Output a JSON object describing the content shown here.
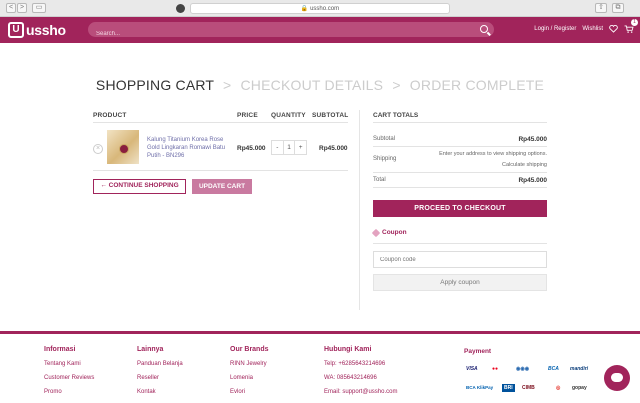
{
  "browser": {
    "url": "ussho.com",
    "nav_back": "<",
    "nav_forward": ">",
    "sidebar_toggle": "▭",
    "share": "⇧",
    "tabs": "⧉"
  },
  "header": {
    "logo_mark": "U",
    "logo_text": "ussho",
    "search_placeholder": "Search...",
    "login_register": "Login / Register",
    "wishlist": "Wishlist",
    "cart_count": "1",
    "brand_color": "#a1245b"
  },
  "steps": {
    "cart": "SHOPPING CART",
    "details": "CHECKOUT DETAILS",
    "complete": "ORDER COMPLETE",
    "separator": ">"
  },
  "cart": {
    "columns": [
      "PRODUCT",
      "PRICE",
      "QUANTITY",
      "SUBTOTAL"
    ],
    "items": [
      {
        "name": "Kalung Titanium Korea Rose Gold Lingkaran Romawi Batu Putih - BN296",
        "price": "Rp45.000",
        "quantity": "1",
        "subtotal": "Rp45.000",
        "remove": "×"
      }
    ],
    "qty_minus": "-",
    "qty_plus": "+",
    "continue_label": "← CONTINUE SHOPPING",
    "update_label": "UPDATE CART"
  },
  "totals": {
    "heading": "CART TOTALS",
    "subtotal_label": "Subtotal",
    "subtotal_value": "Rp45.000",
    "shipping_label": "Shipping",
    "shipping_note": "Enter your address to view shipping options.",
    "calc_shipping": "Calculate shipping",
    "total_label": "Total",
    "total_value": "Rp45.000",
    "checkout_label": "PROCEED TO CHECKOUT",
    "coupon_heading": "Coupon",
    "coupon_placeholder": "Coupon code",
    "apply_label": "Apply coupon"
  },
  "footer": {
    "informasi": {
      "title": "Informasi",
      "links": [
        "Tentang Kami",
        "Customer Reviews",
        "Promo"
      ]
    },
    "lainnya": {
      "title": "Lainnya",
      "links": [
        "Panduan Belanja",
        "Reseller",
        "Kontak"
      ]
    },
    "brands": {
      "title": "Our Brands",
      "links": [
        "RINN Jewelry",
        "Lomenia",
        "Evlori"
      ]
    },
    "hubungi": {
      "title": "Hubungi Kami",
      "links": [
        "Telp: +6285643214696",
        "WA: 085643214696",
        "Email: support@ussho.com"
      ]
    },
    "payment": {
      "title": "Payment",
      "row1": [
        "VISA",
        "●●",
        "◉◉◉",
        "BCA",
        "mandiri"
      ],
      "row2": [
        "BCA KlikPay",
        "BRI",
        "CIMB",
        "◎",
        "gopay"
      ]
    }
  }
}
